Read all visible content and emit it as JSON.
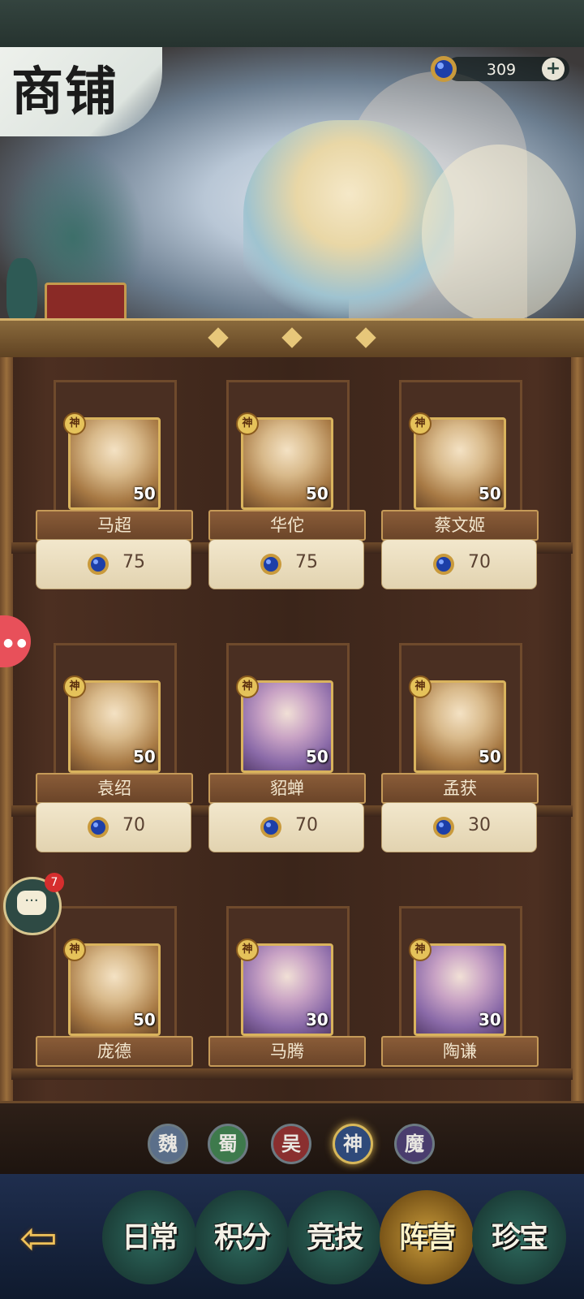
{
  "header": {
    "title": "商铺"
  },
  "currency": {
    "amount": "309",
    "plus_label": "+",
    "icon": "blue-gem-icon"
  },
  "heroes": [
    {
      "name": "马超",
      "tier": "神",
      "level": "50",
      "price": "75"
    },
    {
      "name": "华佗",
      "tier": "神",
      "level": "50",
      "price": "75"
    },
    {
      "name": "蔡文姬",
      "tier": "神",
      "level": "50",
      "price": "70"
    },
    {
      "name": "袁绍",
      "tier": "神",
      "level": "50",
      "price": "70"
    },
    {
      "name": "貂蝉",
      "tier": "神",
      "level": "50",
      "price": "70"
    },
    {
      "name": "孟获",
      "tier": "神",
      "level": "50",
      "price": "30"
    },
    {
      "name": "庞德",
      "tier": "神",
      "level": "50",
      "price": ""
    },
    {
      "name": "马腾",
      "tier": "神",
      "level": "30",
      "price": ""
    },
    {
      "name": "陶谦",
      "tier": "神",
      "level": "30",
      "price": ""
    }
  ],
  "factions": [
    {
      "label": "魏",
      "color": "#5b6f8a",
      "active": false
    },
    {
      "label": "蜀",
      "color": "#3e7a4c",
      "active": false
    },
    {
      "label": "吴",
      "color": "#8a2f2f",
      "active": false
    },
    {
      "label": "神",
      "color": "#2f4a7a",
      "active": true
    },
    {
      "label": "魔",
      "color": "#4a3d6e",
      "active": false
    }
  ],
  "nav": {
    "back_icon": "back-arrow-icon",
    "tabs": [
      {
        "label": "日常",
        "active": false
      },
      {
        "label": "积分",
        "active": false
      },
      {
        "label": "竞技",
        "active": false
      },
      {
        "label": "阵营",
        "active": true
      },
      {
        "label": "珍宝",
        "active": false
      }
    ]
  },
  "chat": {
    "badge_count": "7",
    "icon": "chat-bubble-icon"
  },
  "side_widget": {
    "icon": "game-controller-icon"
  }
}
